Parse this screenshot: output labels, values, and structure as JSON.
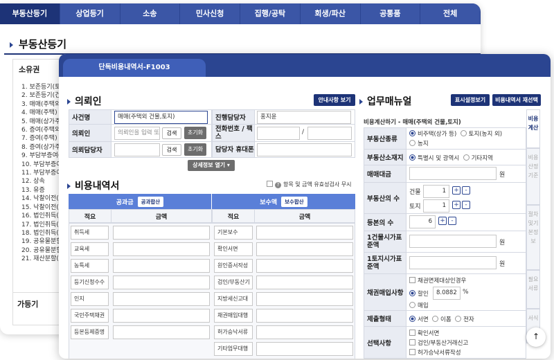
{
  "back": {
    "tabs": [
      "부동산등기",
      "상업등기",
      "소송",
      "민사신청",
      "집행/공탁",
      "회생/파산",
      "공통품",
      "전체"
    ],
    "title": "부동산등기",
    "box_header": "소유권",
    "items": [
      "1. 보존등기(토",
      "2. 보존등기(건",
      "3. 매매(주택외",
      "4. 매매(주택)",
      "5. 매매(상가주",
      "6. 증여(주택외",
      "7. 증여(주택)",
      "8. 증여(상가주",
      "9. 부담부증여(",
      "10. 부담부증여(",
      "11. 부담부증여(",
      "12. 상속",
      "13. 유증",
      "14. 낙찰이전(주",
      "15. 낙찰이전(주",
      "16. 법인취득(주",
      "17. 법인취득(주",
      "18. 법인취득(미",
      "19. 공유물분할",
      "20. 공유물분할",
      "21. 재산분할(이"
    ],
    "footer": "가등기"
  },
  "front": {
    "tab": "단독비용내역서-F1003",
    "client": {
      "title": "의뢰인",
      "guide_button": "안내사항 보기",
      "case_label": "사건명",
      "case_value": "매매(주택외 건물,토지)",
      "manager_label": "진행담당자",
      "manager_value": "홍지윤",
      "client_label": "의뢰인",
      "client_placeholder": "의뢰인을 입력 또",
      "search": "검색",
      "reset": "초기화",
      "phone_label": "전화번호 / 팩스",
      "slash": "/",
      "client_manager_label": "의뢰담당자",
      "mobile_label": "담당자 휴대폰",
      "more": "상세정보 열기 ▾"
    },
    "cost": {
      "title": "비용내역서",
      "check_text": "항목 및 금액 유효성검사 무시",
      "public_header": "공과금",
      "public_sum": "공과합산",
      "fee_header": "보수액",
      "fee_sum": "보수합산",
      "col_item": "적요",
      "col_amount": "금액",
      "public_items": [
        "취득세",
        "교육세",
        "농특세",
        "등기신청수수",
        "인지",
        "국민주택채권",
        "등본등제증명"
      ],
      "fee_items": [
        "기본보수",
        "확인서면",
        "원인증서작성",
        "검인/부동산기",
        "지방세신고대",
        "채권매입대행",
        "허가승낙서류",
        "기타업무대행"
      ]
    },
    "manual": {
      "title": "업무매뉴얼",
      "display_btn": "표시설정보기",
      "reselect_btn": "비용내역서 재선택",
      "subtitle": "비용계산하기 - 매매(주택외 건물,토지)",
      "rows": {
        "type_label": "부동산종류",
        "type_opts": [
          "비주택(상가 등)",
          "토지(농지 외)",
          "농지"
        ],
        "loc_label": "부동산소재지",
        "loc_opts": [
          "특별시 및 광역시",
          "기타지역"
        ],
        "price_label": "매매대금",
        "won": "원",
        "count_label": "부동산의 수",
        "building": "건물",
        "building_val": "1",
        "land": "토지",
        "land_val": "1",
        "copies_label": "등본의 수",
        "copies_val": "6",
        "b1_label": "1건물시가표준액",
        "l1_label": "1토지시가표준액",
        "bond_label": "채권매입사항",
        "bond_check": "채권면제대상인경우",
        "discount": "할인",
        "discount_val": "8.0882",
        "pct": "%",
        "buy": "매입",
        "submit_label": "제출형태",
        "submit_opts": [
          "서면",
          "이폼",
          "전자"
        ],
        "select_label": "선택사항",
        "select_opts": [
          "확인서면",
          "검인/부동산거래신고",
          "허가승낙서류작성"
        ]
      },
      "side_tabs": [
        "비용계산",
        "비용산정기준",
        "절차및기본정보",
        "필요서류",
        "서식"
      ]
    }
  }
}
